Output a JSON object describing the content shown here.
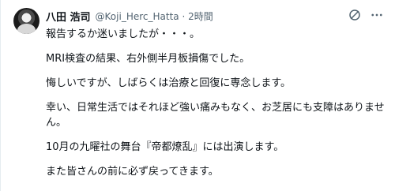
{
  "author": {
    "display_name": "八田 浩司",
    "handle": "@Koji_Herc_Hatta",
    "separator": "·",
    "time": "2時間"
  },
  "icons": {
    "grok": "slash-circle-icon",
    "menu": "more-icon"
  },
  "body": {
    "line_1": "報告するか迷いましたが・・・。",
    "line_2": "MRI検査の結果、右外側半月板損傷でした。",
    "line_3": "悔しいですが、しばらくは治療と回復に専念します。",
    "line_4": "幸い、日常生活ではそれほど強い痛みもなく、お芝居にも支障はありませ",
    "line_5": "ん。",
    "line_6": "10月の九曜社の舞台『帝都燎乱』には出演します。",
    "line_7": "また皆さんの前に必ず戻ってきます。"
  }
}
